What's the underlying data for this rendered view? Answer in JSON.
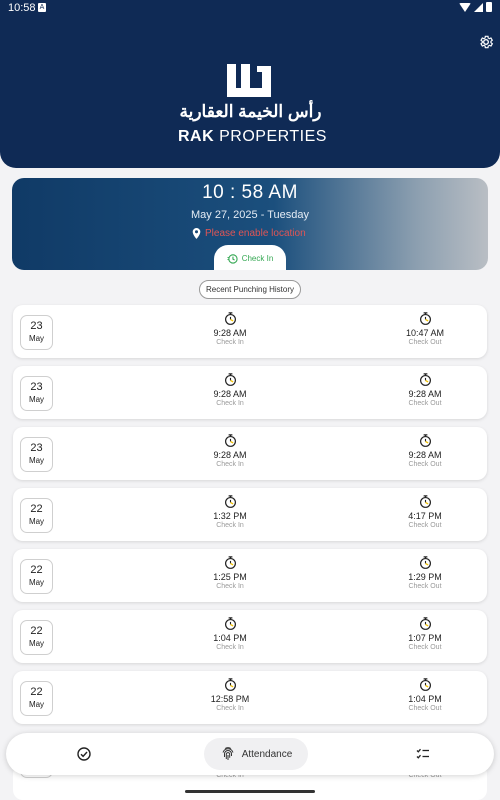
{
  "status_bar": {
    "time": "10:58",
    "notification_letter": "A"
  },
  "brand": {
    "arabic_name": "رأس الخيمة العقارية",
    "english_bold": "RAK",
    "english_rest": " PROPERTIES"
  },
  "attendance": {
    "time": "10 : 58 AM",
    "date": "May 27, 2025 - Tuesday",
    "location_warning": "Please enable location",
    "check_in_button": "Check In",
    "history_button": "Recent Punching History"
  },
  "records": [
    {
      "day": "23",
      "month": "May",
      "in_time": "9:28 AM",
      "in_label": "Check In",
      "out_time": "10:47 AM",
      "out_label": "Check Out"
    },
    {
      "day": "23",
      "month": "May",
      "in_time": "9:28 AM",
      "in_label": "Check In",
      "out_time": "9:28 AM",
      "out_label": "Check Out"
    },
    {
      "day": "23",
      "month": "May",
      "in_time": "9:28 AM",
      "in_label": "Check In",
      "out_time": "9:28 AM",
      "out_label": "Check Out"
    },
    {
      "day": "22",
      "month": "May",
      "in_time": "1:32 PM",
      "in_label": "Check In",
      "out_time": "4:17 PM",
      "out_label": "Check Out"
    },
    {
      "day": "22",
      "month": "May",
      "in_time": "1:25 PM",
      "in_label": "Check In",
      "out_time": "1:29 PM",
      "out_label": "Check Out"
    },
    {
      "day": "22",
      "month": "May",
      "in_time": "1:04 PM",
      "in_label": "Check In",
      "out_time": "1:07 PM",
      "out_label": "Check Out"
    },
    {
      "day": "22",
      "month": "May",
      "in_time": "12:58 PM",
      "in_label": "Check In",
      "out_time": "1:04 PM",
      "out_label": "Check Out"
    }
  ],
  "partial_record": {
    "in_label": "Check In",
    "out_label": "Check Out"
  },
  "bottom_nav": {
    "active_label": "Attendance"
  },
  "colors": {
    "navy": "#0f2a55",
    "check_in_green": "#35a853",
    "warning_red": "#e05555",
    "punch_icon_yellow": "#f2c200"
  }
}
